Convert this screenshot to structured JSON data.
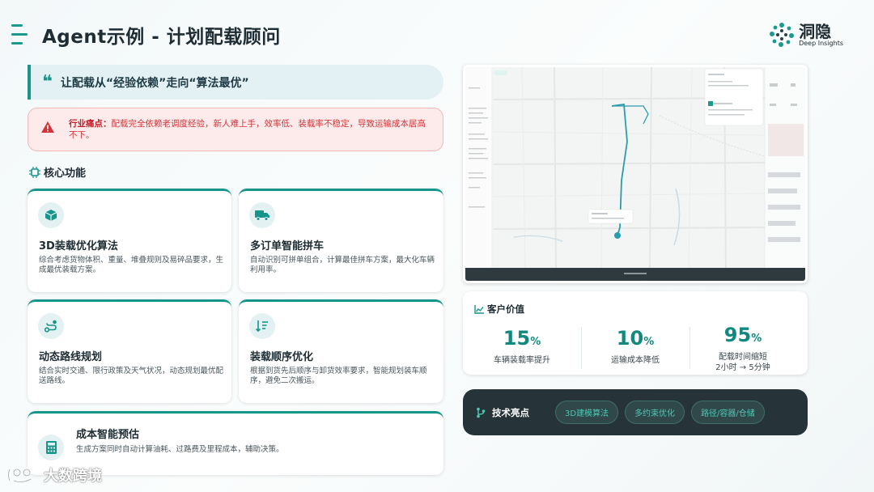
{
  "header": {
    "title": "Agent示例 - 计划配载顾问",
    "logo_text": "洞隐",
    "logo_sub": "Deep Insights"
  },
  "quote": {
    "mark": "❝",
    "text": "让配载从“经验依赖”走向“算法最优”"
  },
  "pain": {
    "label": "行业痛点：",
    "text": "配载完全依赖老调度经验，新人难上手，效率低、装载率不稳定，导致运输成本居高不下。"
  },
  "core": {
    "title": "核心功能",
    "cards": [
      {
        "icon": "cube-icon",
        "title": "3D装载优化算法",
        "desc": "综合考虑货物体积、重量、堆叠规则及易碎品要求，生成最优装载方案。"
      },
      {
        "icon": "truck-icon",
        "title": "多订单智能拼车",
        "desc": "自动识别可拼单组合，计算最佳拼车方案，最大化车辆利用率。"
      },
      {
        "icon": "route-icon",
        "title": "动态路线规划",
        "desc": "结合实时交通、限行政策及天气状况，动态规划最优配送路线。"
      },
      {
        "icon": "sort-icon",
        "title": "装载顺序优化",
        "desc": "根据到货先后顺序与卸货效率要求，智能规划装车顺序，避免二次搬运。"
      },
      {
        "icon": "calculator-icon",
        "title": "成本智能预估",
        "desc": "生成方案同时自动计算油耗、过路费及里程成本，辅助决策。"
      }
    ]
  },
  "value": {
    "title": "客户价值",
    "metrics": [
      {
        "num": "15",
        "unit": "%",
        "label": "车辆装载率提升",
        "sub": ""
      },
      {
        "num": "10",
        "unit": "%",
        "label": "运输成本降低",
        "sub": ""
      },
      {
        "num": "95",
        "unit": "%",
        "label": "配载时间缩短",
        "sub": "2小时 → 5分钟"
      }
    ]
  },
  "tech": {
    "title": "技术亮点",
    "tags": [
      "3D建模算法",
      "多约束优化",
      "路径/容器/仓储"
    ]
  },
  "watermark": {
    "text": "大数跨境"
  },
  "colors": {
    "accent": "#16958a",
    "dark": "#263338",
    "pain_bg": "#fdeaea",
    "pain_text": "#d2343a"
  }
}
